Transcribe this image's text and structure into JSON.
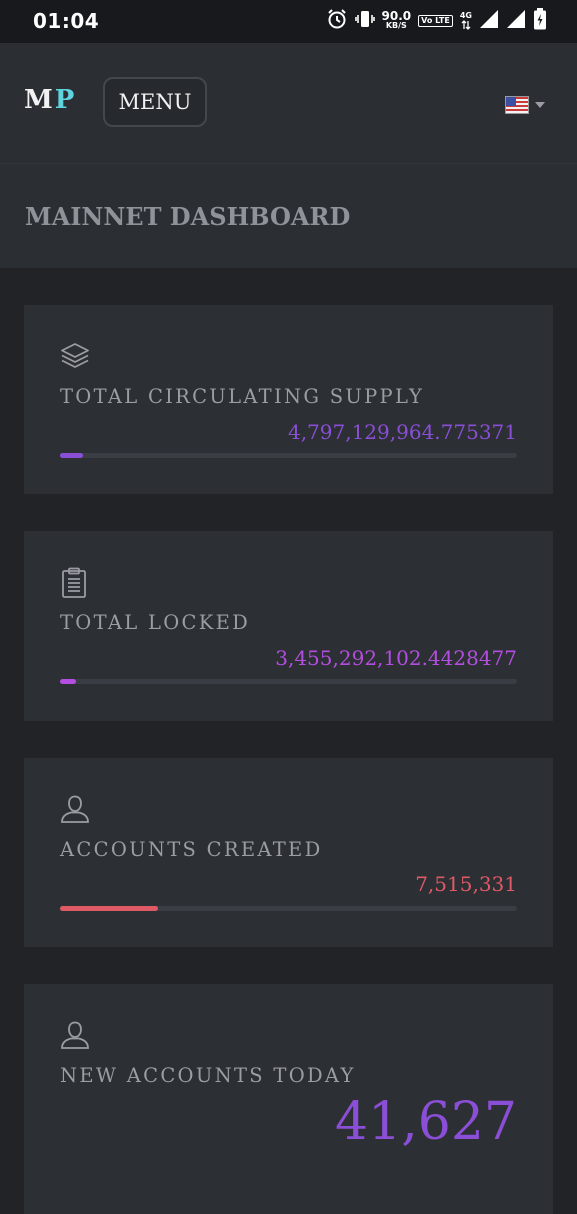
{
  "status_bar": {
    "time": "01:04",
    "net_speed_value": "90.0",
    "net_speed_unit": "KB/S",
    "volte_label": "Vo LTE",
    "network_type": "4G",
    "icons": [
      "alarm-icon",
      "vibrate-icon",
      "data-arrows-icon",
      "signal-icon",
      "battery-charging-icon"
    ]
  },
  "header": {
    "logo_m": "M",
    "logo_p": "P",
    "menu_label": "MENU",
    "language_icon": "us-flag-icon"
  },
  "page": {
    "title": "MAINNET DASHBOARD"
  },
  "stats": [
    {
      "icon": "layers-icon",
      "label": "TOTAL CIRCULATING SUPPLY",
      "value": "4,797,129,964.775371",
      "color": "#8a4fd6",
      "progress": 0.05
    },
    {
      "icon": "clipboard-icon",
      "label": "TOTAL LOCKED",
      "value": "3,455,292,102.4428477",
      "color": "#b44ee0",
      "progress": 0.035
    },
    {
      "icon": "user-icon",
      "label": "ACCOUNTS CREATED",
      "value": "7,515,331",
      "color": "#e05a66",
      "progress": 0.215
    },
    {
      "icon": "user-icon",
      "label": "NEW ACCOUNTS TODAY",
      "value": "41,627",
      "color": "#8a4fd6"
    }
  ],
  "colors": {
    "background": "#212327",
    "panel": "#2c2f34",
    "logo_accent": "#5fd3de"
  }
}
